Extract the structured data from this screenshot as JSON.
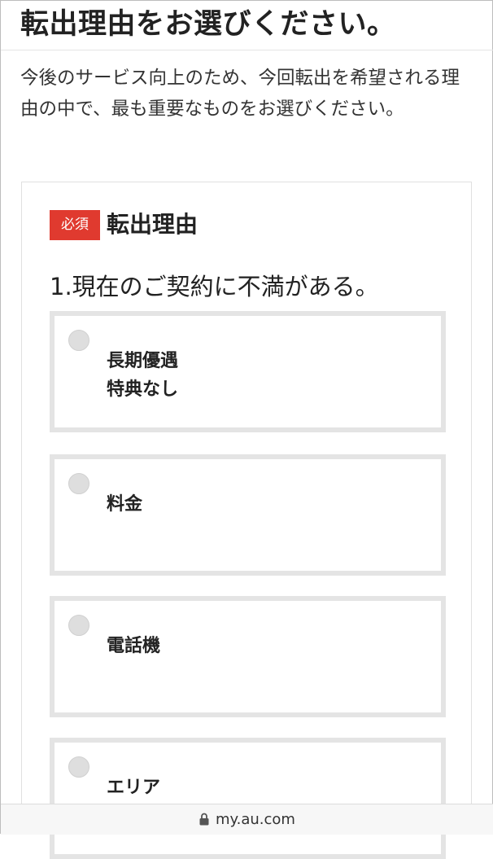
{
  "page": {
    "title": "転出理由をお選びください。",
    "intro": "今後のサービス向上のため、今回転出を希望される理由の中で、最も重要なものをお選びください。"
  },
  "form": {
    "required_badge": "必須",
    "field_label": "転出理由",
    "question": "1.現在のご契約に不満がある。",
    "options": [
      {
        "lines": [
          "長期優遇",
          "特典なし"
        ],
        "selected": false
      },
      {
        "lines": [
          "料金"
        ],
        "selected": false
      },
      {
        "lines": [
          "電話機"
        ],
        "selected": false
      },
      {
        "lines": [
          "エリア"
        ],
        "selected": false
      }
    ]
  },
  "browser": {
    "url": "my.au.com",
    "lock_icon": "lock-icon"
  },
  "colors": {
    "required_badge": "#e03a2f",
    "option_border": "#e4e4e4",
    "radio": "#dedede"
  }
}
